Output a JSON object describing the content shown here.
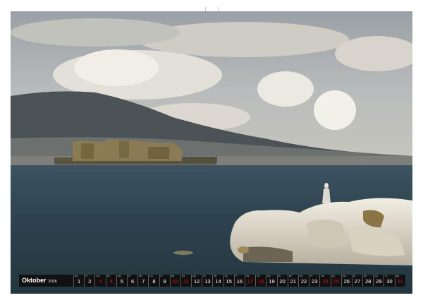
{
  "calendar": {
    "month": "Oktober",
    "year": "2026",
    "weekend_color": "#d2131b",
    "days": [
      {
        "day": "1",
        "weekday": "Do",
        "weekend": false
      },
      {
        "day": "2",
        "weekday": "Fr",
        "weekend": false
      },
      {
        "day": "3",
        "weekday": "Sa",
        "weekend": true
      },
      {
        "day": "4",
        "weekday": "So",
        "weekend": true
      },
      {
        "day": "5",
        "weekday": "Mo",
        "weekend": false
      },
      {
        "day": "6",
        "weekday": "Di",
        "weekend": false
      },
      {
        "day": "7",
        "weekday": "Mi",
        "weekend": false
      },
      {
        "day": "8",
        "weekday": "Do",
        "weekend": false
      },
      {
        "day": "9",
        "weekday": "Fr",
        "weekend": false
      },
      {
        "day": "10",
        "weekday": "Sa",
        "weekend": true
      },
      {
        "day": "11",
        "weekday": "So",
        "weekend": true
      },
      {
        "day": "12",
        "weekday": "Mo",
        "weekend": false
      },
      {
        "day": "13",
        "weekday": "Di",
        "weekend": false
      },
      {
        "day": "14",
        "weekday": "Mi",
        "weekend": false
      },
      {
        "day": "15",
        "weekday": "Do",
        "weekend": false
      },
      {
        "day": "16",
        "weekday": "Fr",
        "weekend": false
      },
      {
        "day": "17",
        "weekday": "Sa",
        "weekend": true
      },
      {
        "day": "18",
        "weekday": "So",
        "weekend": true
      },
      {
        "day": "19",
        "weekday": "Mo",
        "weekend": false
      },
      {
        "day": "20",
        "weekday": "Di",
        "weekend": false
      },
      {
        "day": "21",
        "weekday": "Mi",
        "weekend": false
      },
      {
        "day": "22",
        "weekday": "Do",
        "weekend": false
      },
      {
        "day": "23",
        "weekday": "Fr",
        "weekend": false
      },
      {
        "day": "24",
        "weekday": "Sa",
        "weekend": true
      },
      {
        "day": "25",
        "weekday": "So",
        "weekend": true
      },
      {
        "day": "26",
        "weekday": "Mo",
        "weekend": false
      },
      {
        "day": "27",
        "weekday": "Di",
        "weekend": false
      },
      {
        "day": "28",
        "weekday": "Mi",
        "weekend": false
      },
      {
        "day": "29",
        "weekday": "Do",
        "weekend": false
      },
      {
        "day": "30",
        "weekday": "Fr",
        "weekend": false
      },
      {
        "day": "31",
        "weekday": "Sa",
        "weekend": true
      }
    ]
  }
}
